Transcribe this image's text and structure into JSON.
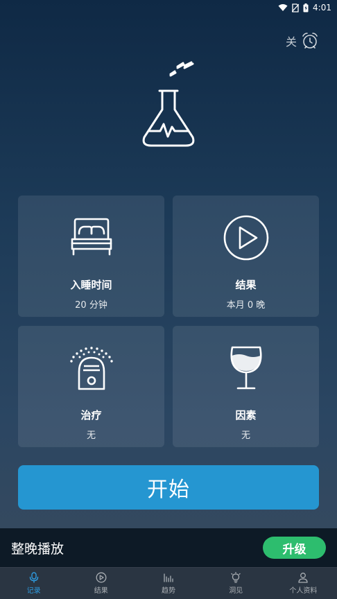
{
  "status_bar": {
    "time": "4:01"
  },
  "alarm": {
    "label": "关"
  },
  "tiles": [
    {
      "title": "入睡时间",
      "subtitle": "20 分钟",
      "icon": "bed-icon"
    },
    {
      "title": "结果",
      "subtitle": "本月 0 晚",
      "icon": "play-circle-icon"
    },
    {
      "title": "治疗",
      "subtitle": "无",
      "icon": "humidifier-icon"
    },
    {
      "title": "因素",
      "subtitle": "无",
      "icon": "wine-glass-icon"
    }
  ],
  "start_button": {
    "label": "开始"
  },
  "promo": {
    "text": "整晚播放",
    "upgrade_label": "升级"
  },
  "nav": [
    {
      "label": "记录",
      "icon": "microphone-icon",
      "active": true
    },
    {
      "label": "结果",
      "icon": "play-icon"
    },
    {
      "label": "趋势",
      "icon": "bar-chart-icon"
    },
    {
      "label": "洞见",
      "icon": "lightbulb-icon"
    },
    {
      "label": "个人资料",
      "icon": "person-icon"
    }
  ],
  "colors": {
    "accent": "#2596d1",
    "upgrade": "#2dbd6e",
    "nav_active": "#2e9be0"
  }
}
